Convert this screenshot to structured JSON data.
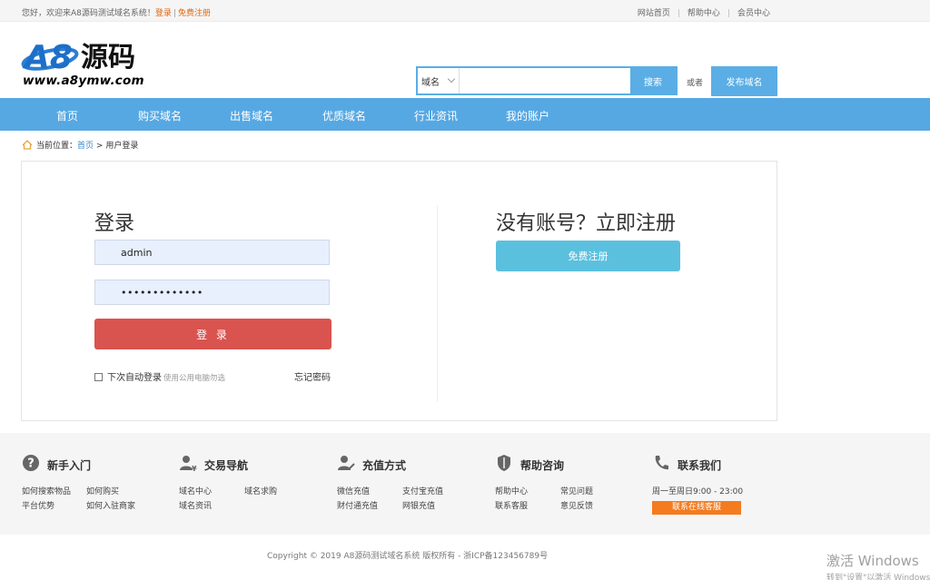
{
  "topbar": {
    "welcome": "您好，欢迎来A8源码测试域名系统！",
    "login_link": "登录",
    "sep": "|",
    "register_link": "免费注册",
    "links": [
      "网站首页",
      "帮助中心",
      "会员中心"
    ]
  },
  "logo": {
    "brand_a8": "A8",
    "brand_cn": "源码",
    "url": "www.a8ymw.com"
  },
  "search": {
    "category": "域名",
    "query": "",
    "button": "搜索",
    "or": "或者",
    "publish": "发布域名"
  },
  "nav": {
    "items": [
      "首页",
      "购买域名",
      "出售域名",
      "优质域名",
      "行业资讯",
      "我的账户"
    ]
  },
  "breadcrumb": {
    "prefix": "当前位置：",
    "home": "首页",
    "arrow": ">",
    "current": "用户登录"
  },
  "login": {
    "title": "登录",
    "username": "admin",
    "password": "•••••••••••••",
    "submit": "登 录",
    "remember": "下次自动登录",
    "remember_hint": "使用公用电脑勿选",
    "forgot": "忘记密码"
  },
  "register": {
    "title": "没有账号？立即注册",
    "button": "免费注册"
  },
  "footer": {
    "cols": [
      {
        "title": "新手入门",
        "links": [
          "如何搜索物品",
          "如何购买",
          "平台优势",
          "如何入驻商家"
        ]
      },
      {
        "title": "交易导航",
        "links": [
          "域名中心",
          "域名求购",
          "域名资讯"
        ]
      },
      {
        "title": "充值方式",
        "links": [
          "微信充值",
          "支付宝充值",
          "财付通充值",
          "网银充值"
        ]
      },
      {
        "title": "帮助咨询",
        "links": [
          "帮助中心",
          "常见问题",
          "联系客服",
          "意见反馈"
        ]
      },
      {
        "title": "联系我们",
        "hours": "周一至周日9:00 - 23:00",
        "button": "联系在线客服"
      }
    ],
    "copyright": "Copyright © 2019 A8源码测试域名系统 版权所有 - 浙ICP备123456789号"
  },
  "watermark": {
    "line1": "激活 Windows",
    "line2": "转到\"设置\"以激活 Windows。"
  },
  "colors": {
    "nav_blue": "#56a8e3",
    "login_red": "#d9534f",
    "register_cyan": "#5bc0de",
    "contact_orange": "#f47b20",
    "link_orange": "#e8650a"
  }
}
